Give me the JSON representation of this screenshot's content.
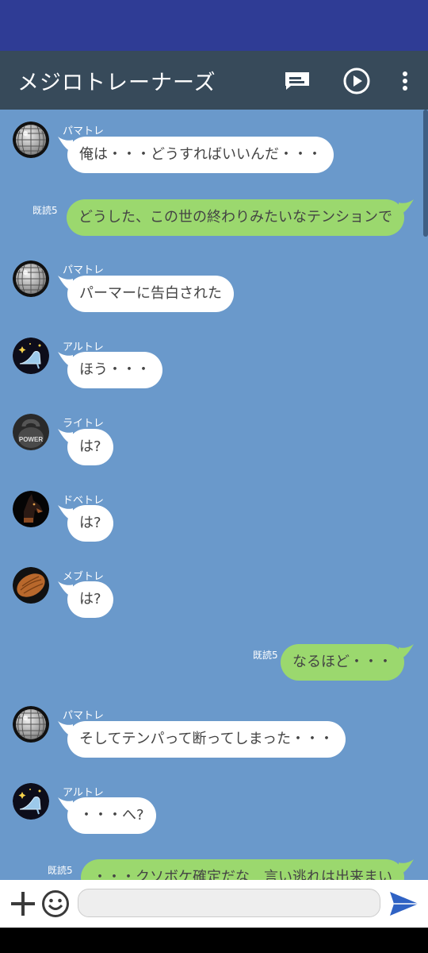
{
  "header": {
    "title": "メジロトレーナーズ"
  },
  "icons": {
    "notes": "speech-note-icon",
    "play": "play-circle-icon",
    "menu": "more-vertical-icon",
    "add": "plus-icon",
    "emoji": "smiley-icon",
    "send": "send-arrow-icon"
  },
  "colors": {
    "header": "#374a5a",
    "chat_bg": "#6a99cb",
    "outgoing": "#9bd86e",
    "incoming": "#ffffff",
    "status_bar": "#2f3c95"
  },
  "messages": [
    {
      "sender": "パマトレ",
      "text": "俺は・・・どうすればいいんだ・・・",
      "avatar": "disco-ball"
    },
    {
      "read": "既読5",
      "text": "どうした、この世の終わりみたいなテンションで"
    },
    {
      "sender": "パマトレ",
      "text": "パーマーに告白された",
      "avatar": "disco-ball"
    },
    {
      "sender": "アルトレ",
      "text": "ほう・・・",
      "avatar": "glass-slipper"
    },
    {
      "sender": "ライトレ",
      "text": "は?",
      "avatar": "kettlebell",
      "avatar_text": "POWER"
    },
    {
      "sender": "ドベトレ",
      "text": "は?",
      "avatar": "doberman"
    },
    {
      "sender": "メブトレ",
      "text": "は?",
      "avatar": "almond"
    },
    {
      "read": "既読5",
      "text": "なるほど・・・"
    },
    {
      "sender": "パマトレ",
      "text": "そしてテンパって断ってしまった・・・",
      "avatar": "disco-ball"
    },
    {
      "sender": "アルトレ",
      "text": "・・・へ?",
      "avatar": "glass-slipper"
    },
    {
      "read": "既読5",
      "text": "・・・クソボケ確定だな　言い逃れは出来まい"
    }
  ],
  "input": {
    "placeholder": ""
  }
}
